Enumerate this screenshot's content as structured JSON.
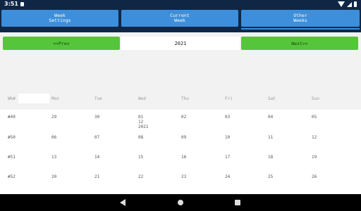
{
  "status_bar": {
    "time": "3:51",
    "icons": [
      "sd-card-icon",
      "wifi-icon",
      "signal-icon",
      "battery-icon"
    ]
  },
  "tabs": [
    {
      "label": "Week\nSettings"
    },
    {
      "label": "Current\nWeek"
    },
    {
      "label": "Other\nWeeks"
    }
  ],
  "nav": {
    "prev_label": "<<Prev",
    "year": "2021",
    "next_label": "Next>>"
  },
  "calendar": {
    "headers": [
      "Wk#",
      "Mon",
      "Tue",
      "Wed",
      "Thu",
      "Fri",
      "Sat",
      "Sun"
    ],
    "weeks": [
      [
        "#49",
        "29",
        "30",
        "01\n12\n2021",
        "02",
        "03",
        "04",
        "05"
      ],
      [
        "#50",
        "06",
        "07",
        "08",
        "09",
        "10",
        "11",
        "12"
      ],
      [
        "#51",
        "13",
        "14",
        "15",
        "16",
        "17",
        "18",
        "19"
      ],
      [
        "#52",
        "20",
        "21",
        "22",
        "23",
        "24",
        "25",
        "26"
      ]
    ]
  },
  "colors": {
    "header_bg": "#0f2745",
    "tab_bg": "#3d8fdb",
    "nav_button_bg": "#55c63b"
  }
}
